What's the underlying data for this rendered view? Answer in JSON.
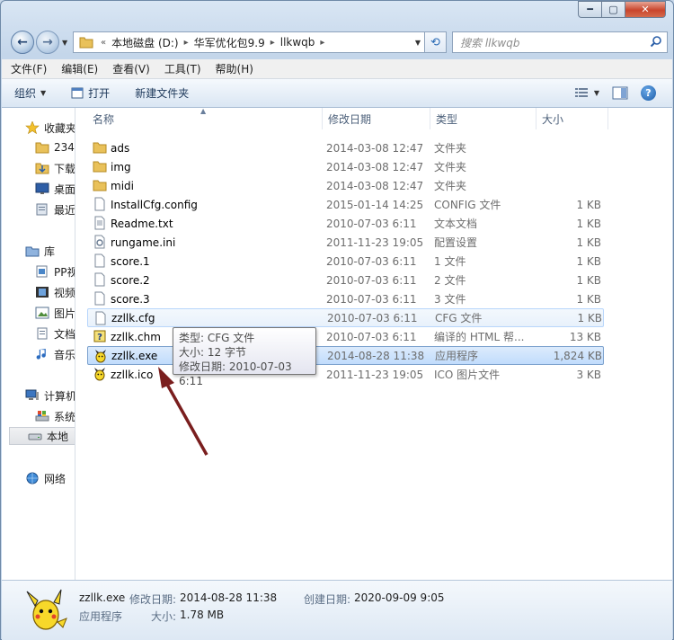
{
  "window": {
    "controls": {
      "minimize": "━",
      "maximize": "▢",
      "close": "✕"
    }
  },
  "address": {
    "overflow": "«",
    "segments": [
      "本地磁盘 (D:)",
      "华军优化包9.9",
      "llkwqb"
    ],
    "search_placeholder": "搜索 llkwqb"
  },
  "menu": [
    "文件(F)",
    "编辑(E)",
    "查看(V)",
    "工具(T)",
    "帮助(H)"
  ],
  "toolbar": {
    "organize": "组织",
    "open": "打开",
    "new_folder": "新建文件夹",
    "help": "?"
  },
  "nav": {
    "items": [
      {
        "label": "收藏夹",
        "icon": "star-icon"
      },
      {
        "label": "234",
        "icon": "folder-icon"
      },
      {
        "label": "下载",
        "icon": "downloads-icon"
      },
      {
        "label": "桌面",
        "icon": "desktop-icon"
      },
      {
        "label": "最近",
        "icon": "recent-icon"
      },
      {
        "label": "库",
        "icon": "library-icon"
      },
      {
        "label": "PP视",
        "icon": "pp-video-icon"
      },
      {
        "label": "视频",
        "icon": "video-icon"
      },
      {
        "label": "图片",
        "icon": "picture-icon"
      },
      {
        "label": "文档",
        "icon": "document-icon"
      },
      {
        "label": "音乐",
        "icon": "music-icon"
      },
      {
        "label": "计算机",
        "icon": "computer-icon"
      },
      {
        "label": "系统",
        "icon": "system-drive-icon"
      },
      {
        "label": "本地",
        "icon": "local-drive-icon"
      },
      {
        "label": "网络",
        "icon": "network-icon"
      }
    ]
  },
  "columns": {
    "name": "名称",
    "date": "修改日期",
    "type": "类型",
    "size": "大小"
  },
  "files": [
    {
      "name": "ads",
      "date": "2014-03-08 12:47",
      "type": "文件夹",
      "size": "",
      "icon": "folder-icon"
    },
    {
      "name": "img",
      "date": "2014-03-08 12:47",
      "type": "文件夹",
      "size": "",
      "icon": "folder-icon"
    },
    {
      "name": "midi",
      "date": "2014-03-08 12:47",
      "type": "文件夹",
      "size": "",
      "icon": "folder-icon"
    },
    {
      "name": "InstallCfg.config",
      "date": "2015-01-14 14:25",
      "type": "CONFIG 文件",
      "size": "1 KB",
      "icon": "file-icon"
    },
    {
      "name": "Readme.txt",
      "date": "2010-07-03 6:11",
      "type": "文本文档",
      "size": "1 KB",
      "icon": "text-file-icon"
    },
    {
      "name": "rungame.ini",
      "date": "2011-11-23 19:05",
      "type": "配置设置",
      "size": "1 KB",
      "icon": "settings-file-icon"
    },
    {
      "name": "score.1",
      "date": "2010-07-03 6:11",
      "type": "1 文件",
      "size": "1 KB",
      "icon": "file-icon"
    },
    {
      "name": "score.2",
      "date": "2010-07-03 6:11",
      "type": "2 文件",
      "size": "1 KB",
      "icon": "file-icon"
    },
    {
      "name": "score.3",
      "date": "2010-07-03 6:11",
      "type": "3 文件",
      "size": "1 KB",
      "icon": "file-icon"
    },
    {
      "name": "zzllk.cfg",
      "date": "2010-07-03 6:11",
      "type": "CFG 文件",
      "size": "1 KB",
      "icon": "file-icon"
    },
    {
      "name": "zzllk.chm",
      "date": "2010-07-03 6:11",
      "type": "编译的 HTML 帮...",
      "size": "13 KB",
      "icon": "chm-help-icon"
    },
    {
      "name": "zzllk.exe",
      "date": "2014-08-28 11:38",
      "type": "应用程序",
      "size": "1,824 KB",
      "icon": "pikachu-app-icon"
    },
    {
      "name": "zzllk.ico",
      "date": "2011-11-23 19:05",
      "type": "ICO 图片文件",
      "size": "3 KB",
      "icon": "pikachu-ico-icon"
    }
  ],
  "tooltip": {
    "type": "类型: CFG 文件",
    "size": "大小: 12 字节",
    "modified": "修改日期: 2010-07-03 6:11"
  },
  "details": {
    "filename": "zzllk.exe",
    "modified_label": "修改日期:",
    "modified_value": "2014-08-28 11:38",
    "created_label": "创建日期:",
    "created_value": "2020-09-09 9:05",
    "kind": "应用程序",
    "size_label": "大小:",
    "size_value": "1.78 MB"
  },
  "colors": {
    "selection": "#c1dcfc",
    "hover_border": "#b8d6fb",
    "arrow": "#7a1e1e",
    "folder": "#e9c15a"
  }
}
